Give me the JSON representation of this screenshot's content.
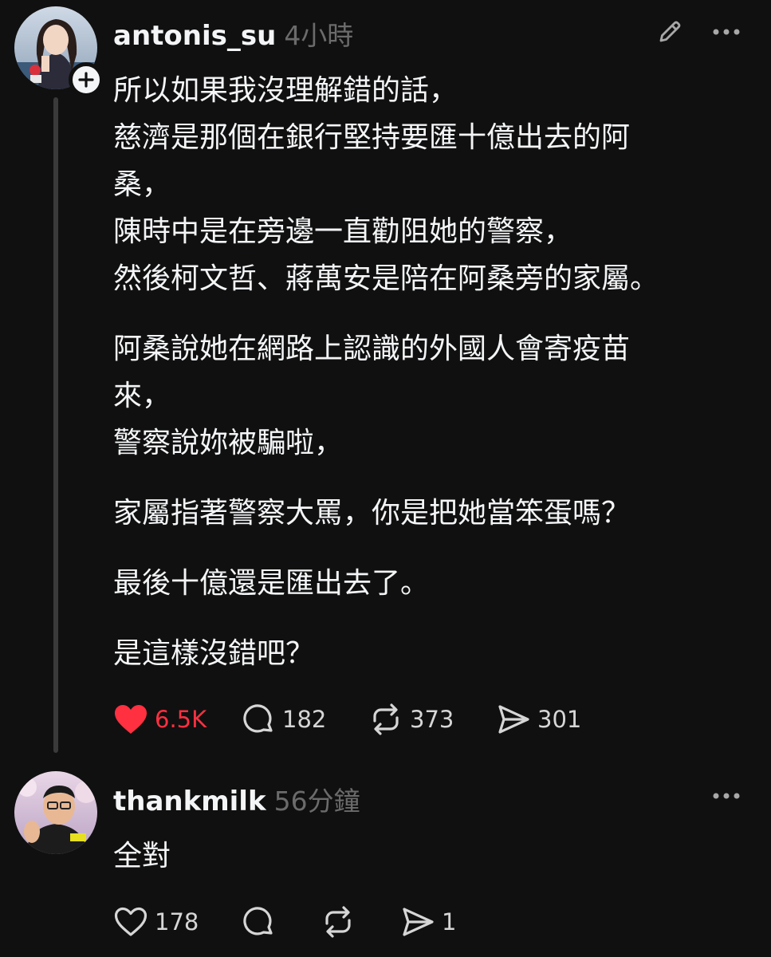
{
  "post1": {
    "username": "antonis_su",
    "time": "4小時",
    "paragraphs": [
      "所以如果我沒理解錯的話，\n慈濟是那個在銀行堅持要匯十億出去的阿\n桑，\n陳時中是在旁邊一直勸阻她的警察，\n然後柯文哲、蔣萬安是陪在阿桑旁的家屬。",
      "阿桑說她在網路上認識的外國人會寄疫苗\n來，\n警察說妳被騙啦，",
      "家屬指著警察大罵，你是把她當笨蛋嗎？",
      "最後十億還是匯出去了。",
      "是這樣沒錯吧？"
    ],
    "likes": "6.5K",
    "comments": "182",
    "reposts": "373",
    "shares": "301"
  },
  "post2": {
    "username": "thankmilk",
    "time": "56分鐘",
    "text": "全對",
    "likes": "178",
    "shares": "1"
  },
  "colors": {
    "background": "#101010",
    "text": "#f3f5f7",
    "muted": "#6b6b6b",
    "like_active": "#ff3040"
  }
}
